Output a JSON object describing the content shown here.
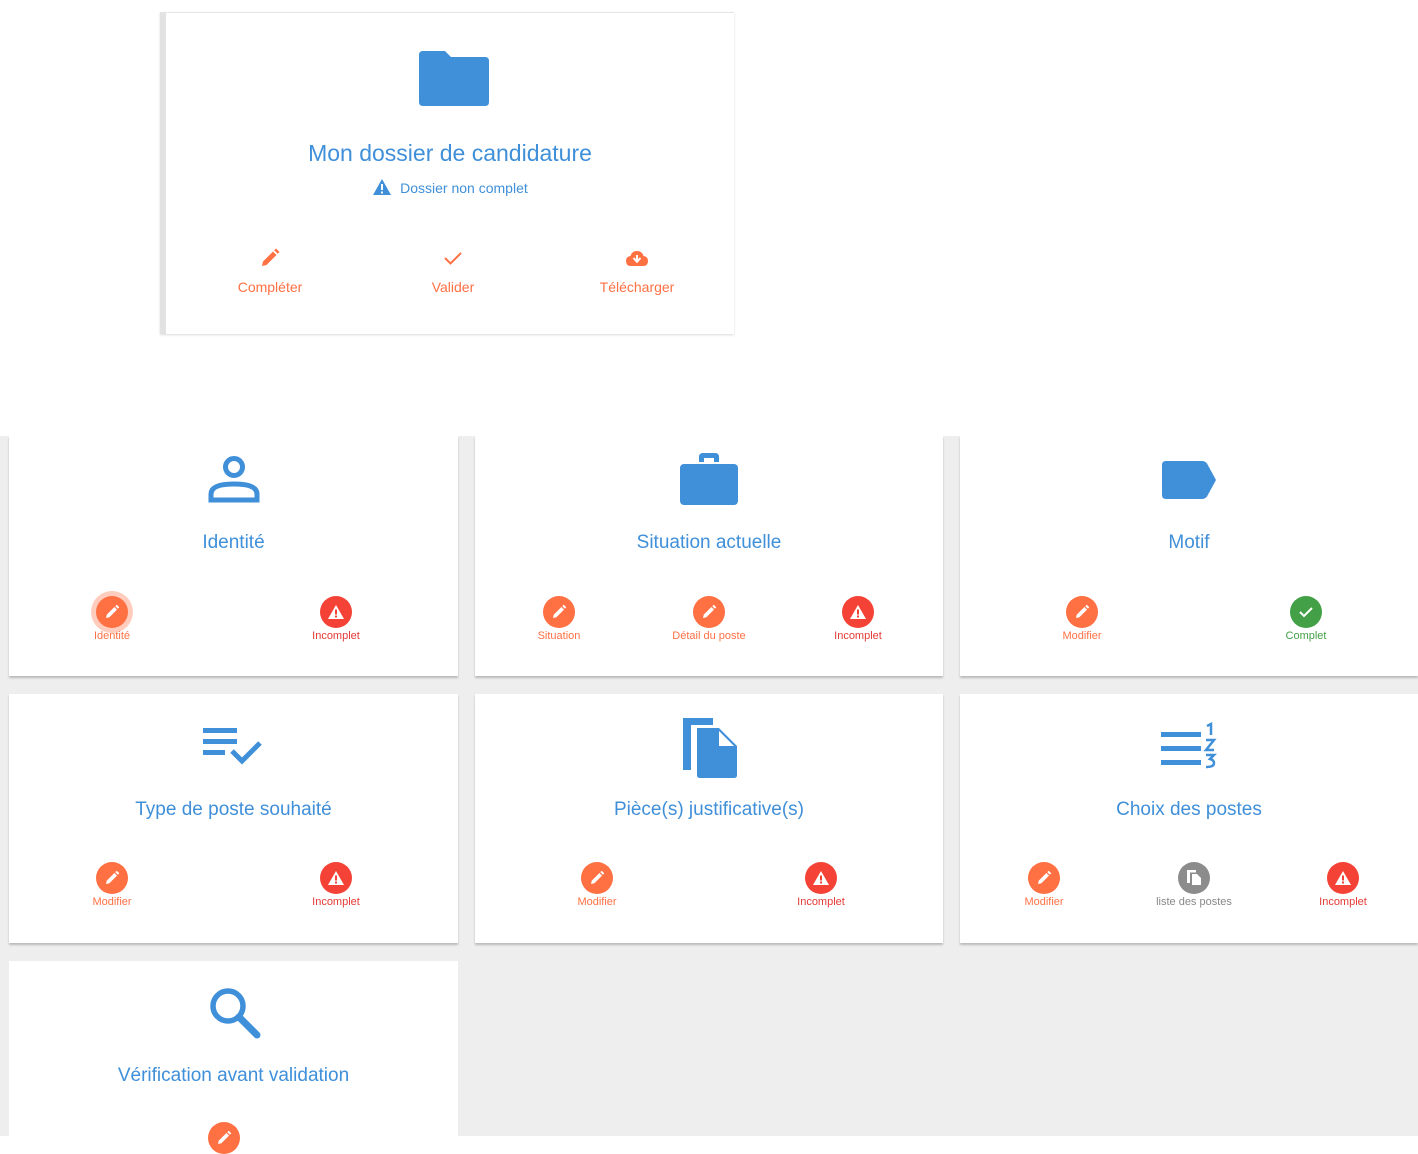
{
  "dossier": {
    "title": "Mon dossier de candidature",
    "status": "Dossier non complet",
    "actions": [
      {
        "label": "Compléter",
        "icon": "pencil-icon"
      },
      {
        "label": "Valider",
        "icon": "check-icon"
      },
      {
        "label": "Télécharger",
        "icon": "cloud-download-icon"
      }
    ]
  },
  "sections": [
    {
      "title": "Identité",
      "icon": "person-icon",
      "actions": [
        {
          "label": "Identité",
          "kind": "edit"
        },
        {
          "label": "Incomplet",
          "kind": "status-incomplete"
        }
      ]
    },
    {
      "title": "Situation actuelle",
      "icon": "briefcase-icon",
      "actions": [
        {
          "label": "Situation",
          "kind": "edit"
        },
        {
          "label": "Détail du poste",
          "kind": "edit"
        },
        {
          "label": "Incomplet",
          "kind": "status-incomplete"
        }
      ]
    },
    {
      "title": "Motif",
      "icon": "label-icon",
      "actions": [
        {
          "label": "Modifier",
          "kind": "edit"
        },
        {
          "label": "Complet",
          "kind": "status-complete"
        }
      ]
    },
    {
      "title": "Type de poste souhaité",
      "icon": "playlist-check-icon",
      "actions": [
        {
          "label": "Modifier",
          "kind": "edit"
        },
        {
          "label": "Incomplet",
          "kind": "status-incomplete"
        }
      ]
    },
    {
      "title": "Pièce(s) justificative(s)",
      "icon": "file-copy-icon",
      "actions": [
        {
          "label": "Modifier",
          "kind": "edit"
        },
        {
          "label": "Incomplet",
          "kind": "status-incomplete"
        }
      ]
    },
    {
      "title": "Choix des postes",
      "icon": "ordered-list-icon",
      "actions": [
        {
          "label": "Modifier",
          "kind": "edit"
        },
        {
          "label": "liste des postes",
          "kind": "list"
        },
        {
          "label": "Incomplet",
          "kind": "status-incomplete"
        }
      ]
    },
    {
      "title": "Vérification avant validation",
      "icon": "search-icon",
      "actions": []
    }
  ],
  "colors": {
    "primary": "#3f8fd9",
    "accent": "#ff7043",
    "error": "#f44336",
    "success": "#43a047",
    "neutral": "#8c8c8c"
  }
}
